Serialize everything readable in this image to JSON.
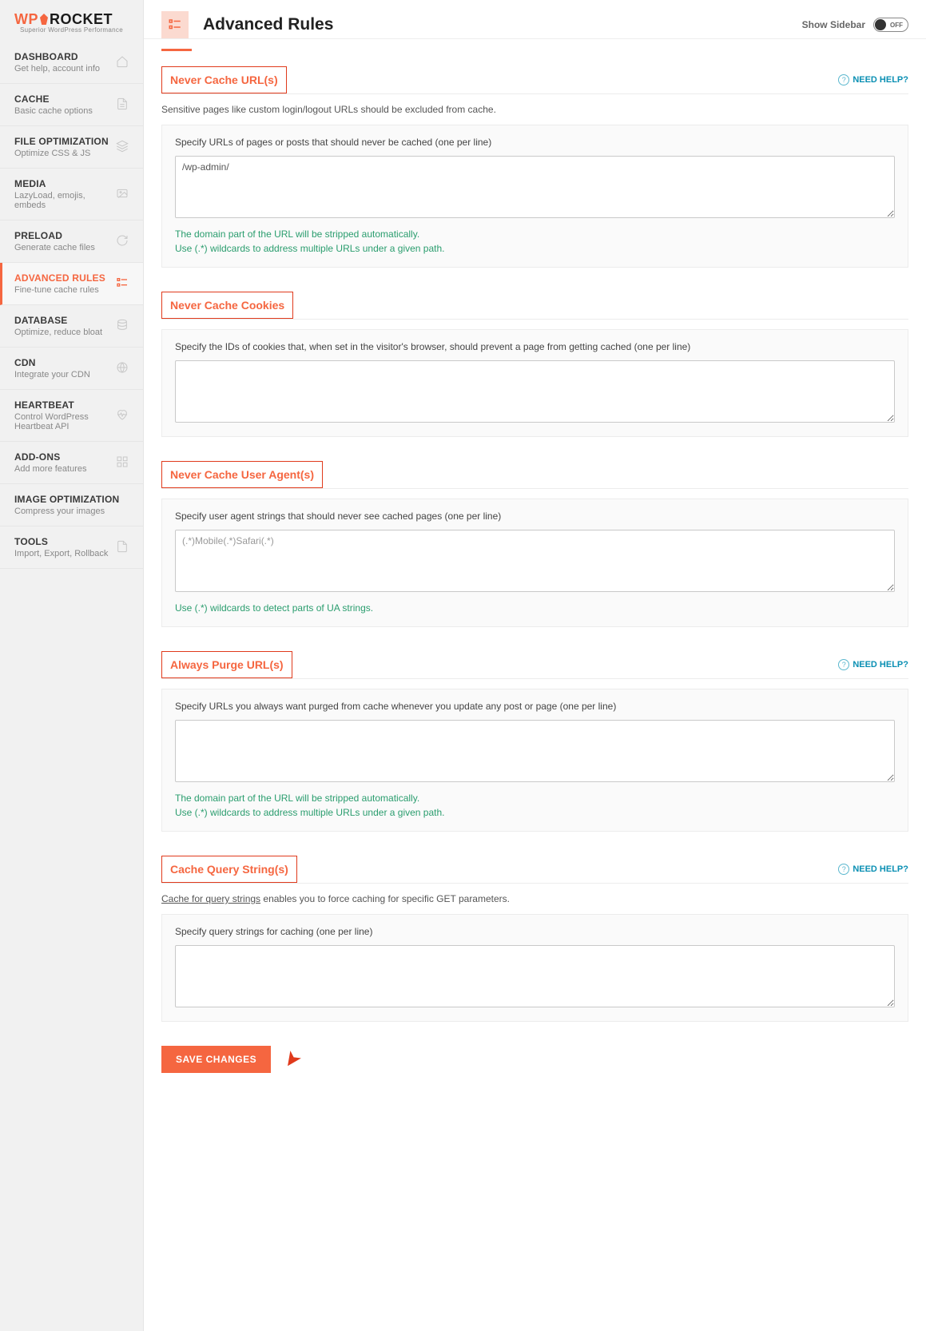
{
  "logo": {
    "wp": "WP",
    "rocket": "ROCKET",
    "tagline": "Superior WordPress Performance"
  },
  "header": {
    "title": "Advanced Rules",
    "show_sidebar": "Show Sidebar",
    "toggle_state": "OFF"
  },
  "nav": [
    {
      "id": "dashboard",
      "title": "DASHBOARD",
      "desc": "Get help, account info",
      "icon": "home"
    },
    {
      "id": "cache",
      "title": "CACHE",
      "desc": "Basic cache options",
      "icon": "file"
    },
    {
      "id": "file-opt",
      "title": "FILE OPTIMIZATION",
      "desc": "Optimize CSS & JS",
      "icon": "layers"
    },
    {
      "id": "media",
      "title": "MEDIA",
      "desc": "LazyLoad, emojis, embeds",
      "icon": "image"
    },
    {
      "id": "preload",
      "title": "PRELOAD",
      "desc": "Generate cache files",
      "icon": "refresh"
    },
    {
      "id": "advanced",
      "title": "ADVANCED RULES",
      "desc": "Fine-tune cache rules",
      "icon": "sliders",
      "active": true
    },
    {
      "id": "database",
      "title": "DATABASE",
      "desc": "Optimize, reduce bloat",
      "icon": "db"
    },
    {
      "id": "cdn",
      "title": "CDN",
      "desc": "Integrate your CDN",
      "icon": "globe"
    },
    {
      "id": "heartbeat",
      "title": "HEARTBEAT",
      "desc": "Control WordPress Heartbeat API",
      "icon": "heart"
    },
    {
      "id": "addons",
      "title": "ADD-ONS",
      "desc": "Add more features",
      "icon": "addons"
    },
    {
      "id": "image-opt",
      "title": "IMAGE OPTIMIZATION",
      "desc": "Compress your images",
      "icon": ""
    },
    {
      "id": "tools",
      "title": "TOOLS",
      "desc": "Import, Export, Rollback",
      "icon": "doc"
    }
  ],
  "help_label": "NEED HELP?",
  "sections": {
    "never_cache_url": {
      "title": "Never Cache URL(s)",
      "sub": "Sensitive pages like custom login/logout URLs should be excluded from cache.",
      "field_label": "Specify URLs of pages or posts that should never be cached (one per line)",
      "value": "/wp-admin/",
      "hint1": "The domain part of the URL will be stripped automatically.",
      "hint2": "Use (.*) wildcards to address multiple URLs under a given path."
    },
    "never_cache_cookies": {
      "title": "Never Cache Cookies",
      "field_label": "Specify the IDs of cookies that, when set in the visitor's browser, should prevent a page from getting cached (one per line)",
      "value": ""
    },
    "never_cache_ua": {
      "title": "Never Cache User Agent(s)",
      "field_label": "Specify user agent strings that should never see cached pages (one per line)",
      "placeholder": "(.*)Mobile(.*)Safari(.*)",
      "value": "",
      "hint": "Use (.*) wildcards to detect parts of UA strings."
    },
    "always_purge": {
      "title": "Always Purge URL(s)",
      "field_label": "Specify URLs you always want purged from cache whenever you update any post or page (one per line)",
      "value": "",
      "hint1": "The domain part of the URL will be stripped automatically.",
      "hint2": "Use (.*) wildcards to address multiple URLs under a given path."
    },
    "cache_query": {
      "title": "Cache Query String(s)",
      "sub_link": "Cache for query strings",
      "sub_rest": " enables you to force caching for specific GET parameters.",
      "field_label": "Specify query strings for caching (one per line)",
      "value": ""
    }
  },
  "save_button": "SAVE CHANGES"
}
